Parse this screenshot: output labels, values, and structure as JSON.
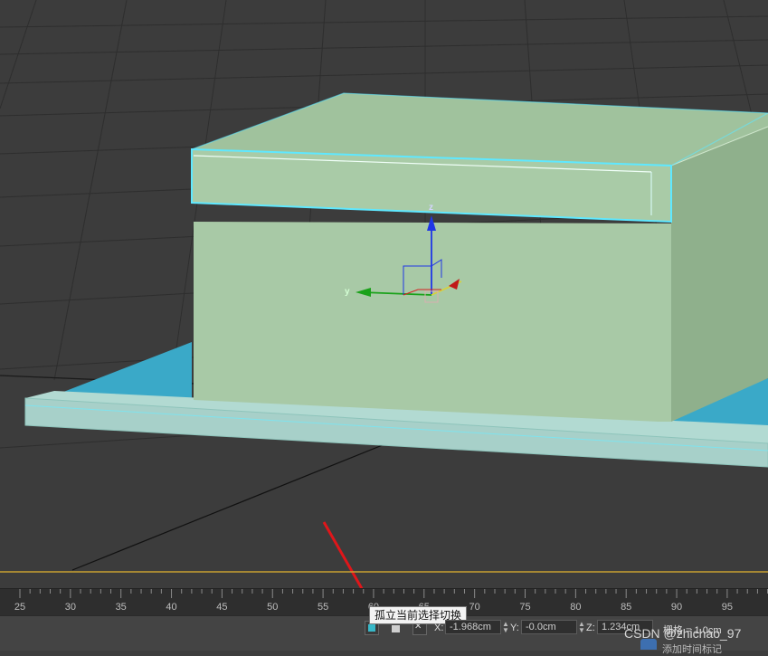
{
  "viewport": {
    "axis_labels": {
      "z": "z",
      "y": "y"
    }
  },
  "timeline": {
    "ticks": [
      "25",
      "30",
      "35",
      "40",
      "45",
      "50",
      "55",
      "60",
      "65",
      "70",
      "75",
      "80",
      "85",
      "90",
      "95"
    ]
  },
  "status_bar": {
    "tooltip": "孤立当前选择切换",
    "x_label": "X:",
    "x_value": "-1.968cm",
    "y_label": "Y:",
    "y_value": "-0.0cm",
    "z_label": "Z:",
    "z_value": "1.234cm",
    "grid_text": "栅格 = 1.0cm",
    "bottom_text": "添加时间标记"
  },
  "watermark": "CSDN @zhichao_97",
  "colors": {
    "selection": "#5fe8ff",
    "box_front": "#a8c9a6",
    "box_top": "#9fbf9c",
    "box_side": "#8fb08c",
    "base": "#a7d0c9",
    "pad": "#3aa9c8",
    "timeline_line": "#c8a030",
    "arrow": "#e0161a"
  },
  "icons": [
    "isolate-selection-icon",
    "lock-icon",
    "absolute-mode-icon",
    "add-time-tag-icon",
    "red-arrow-annotation"
  ]
}
